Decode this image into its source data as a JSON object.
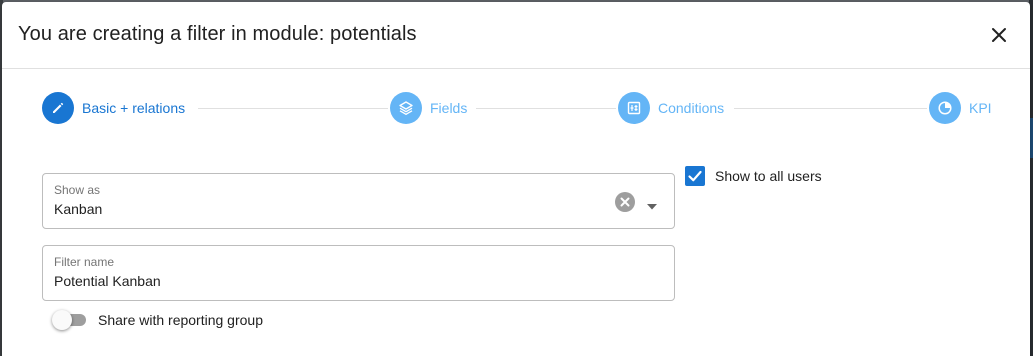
{
  "dialog": {
    "title": "You are creating a filter in module: potentials",
    "close_icon": "close-icon"
  },
  "stepper": {
    "steps": [
      {
        "label": "Basic + relations",
        "icon": "pencil-icon",
        "state": "active"
      },
      {
        "label": "Fields",
        "icon": "layers-icon",
        "state": "inactive"
      },
      {
        "label": "Conditions",
        "icon": "conditions-icon",
        "state": "inactive"
      },
      {
        "label": "KPI",
        "icon": "pie-chart-icon",
        "state": "inactive"
      }
    ]
  },
  "form": {
    "show_as": {
      "label": "Show as",
      "value": "Kanban"
    },
    "filter_name": {
      "label": "Filter name",
      "value": "Potential Kanban"
    },
    "share_toggle": {
      "label": "Share with reporting group",
      "on": false
    },
    "show_all_users": {
      "label": "Show to all users",
      "checked": true
    }
  },
  "colors": {
    "primary": "#1976d2",
    "primary_light": "#64b5f6",
    "text": "#212121",
    "muted": "#757575"
  }
}
